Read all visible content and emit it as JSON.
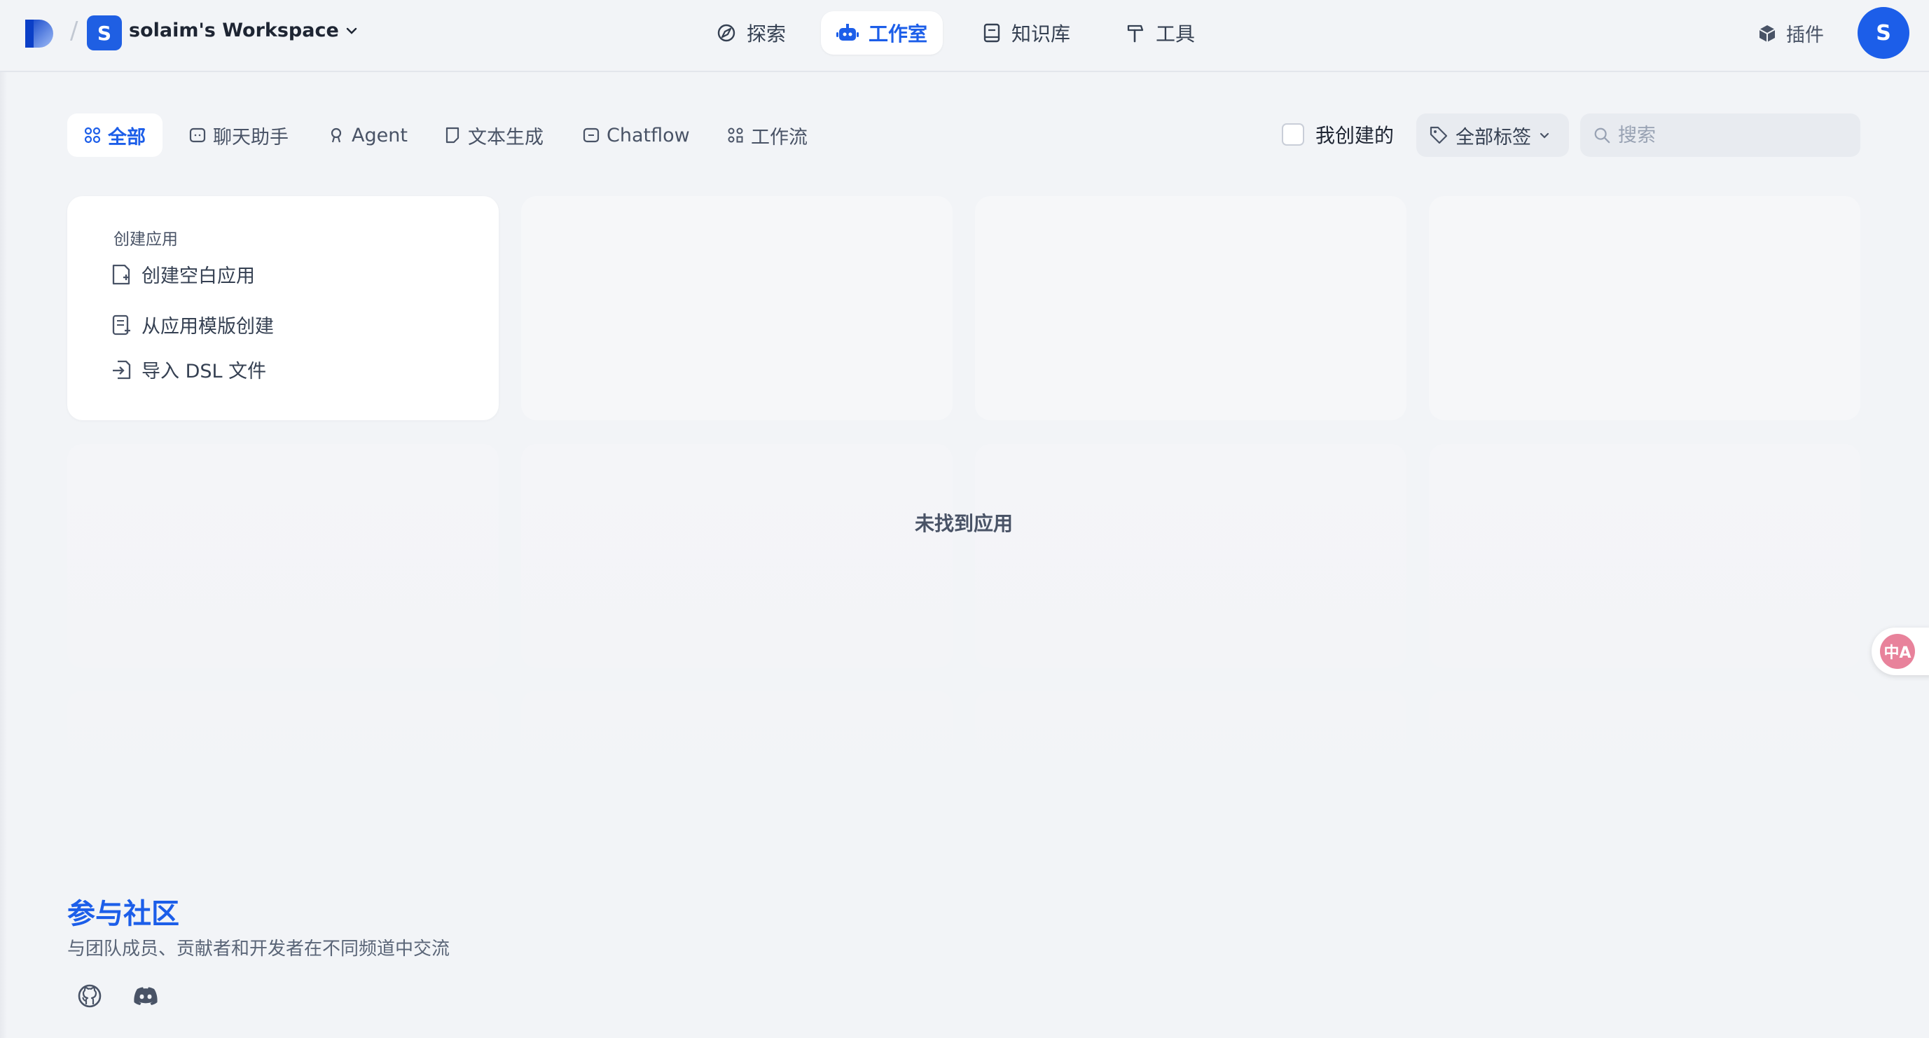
{
  "header": {
    "workspace_initial": "S",
    "workspace_name": "solaim's Workspace",
    "nav": [
      {
        "label": "探索",
        "icon": "compass-icon",
        "active": false
      },
      {
        "label": "工作室",
        "icon": "robot-icon",
        "active": true
      },
      {
        "label": "知识库",
        "icon": "book-icon",
        "active": false
      },
      {
        "label": "工具",
        "icon": "hammer-icon",
        "active": false
      }
    ],
    "plugin_label": "插件",
    "user_initial": "S"
  },
  "filters": {
    "tabs": [
      {
        "label": "全部",
        "icon": "grid-icon",
        "active": true
      },
      {
        "label": "聊天助手",
        "icon": "chat-icon",
        "active": false
      },
      {
        "label": "Agent",
        "icon": "agent-icon",
        "active": false
      },
      {
        "label": "文本生成",
        "icon": "document-icon",
        "active": false
      },
      {
        "label": "Chatflow",
        "icon": "chatflow-icon",
        "active": false
      },
      {
        "label": "工作流",
        "icon": "workflow-icon",
        "active": false
      }
    ],
    "my_created_label": "我创建的",
    "tags_label": "全部标签",
    "search_placeholder": "搜索"
  },
  "create_card": {
    "title": "创建应用",
    "items": [
      {
        "label": "创建空白应用",
        "icon": "new-file-icon"
      },
      {
        "label": "从应用模版创建",
        "icon": "template-icon"
      },
      {
        "label": "导入 DSL 文件",
        "icon": "import-icon"
      }
    ]
  },
  "empty_state": "未找到应用",
  "community": {
    "title": "参与社区",
    "subtitle": "与团队成员、贡献者和开发者在不同频道中交流",
    "links": [
      {
        "icon": "github-icon"
      },
      {
        "icon": "discord-icon"
      }
    ]
  },
  "translate_widget": {
    "label": "中A"
  },
  "colors": {
    "accent": "#1c5ee9",
    "background": "#f2f4f7"
  }
}
